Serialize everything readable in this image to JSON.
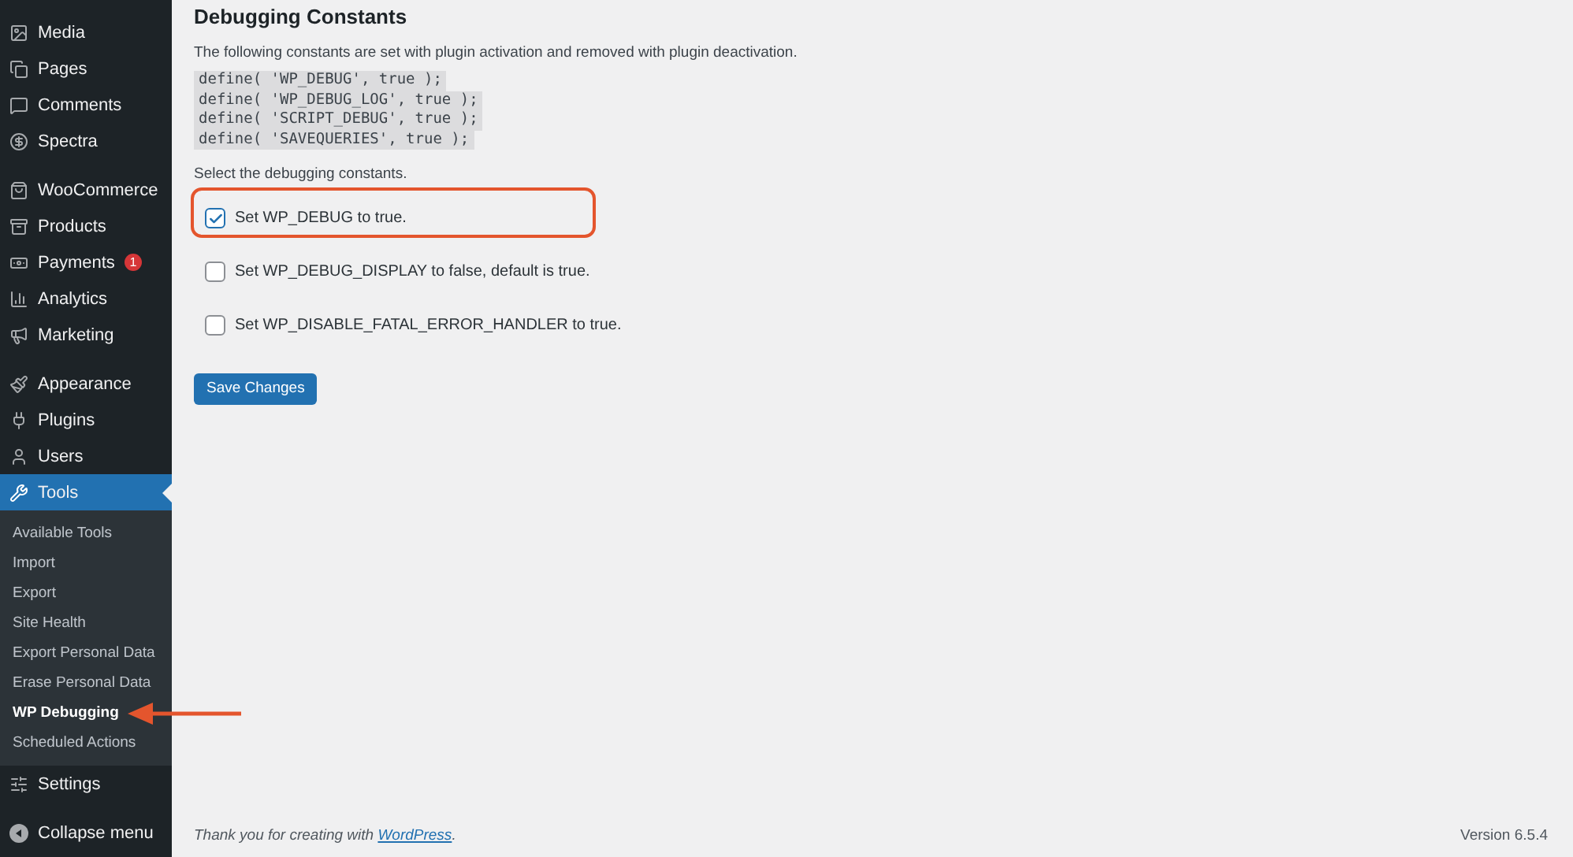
{
  "sidebar": {
    "groups": [
      [
        {
          "label": "Media",
          "selected": false
        },
        {
          "label": "Pages",
          "selected": false
        },
        {
          "label": "Comments",
          "selected": false
        },
        {
          "label": "Spectra",
          "selected": false
        }
      ],
      [
        {
          "label": "WooCommerce",
          "selected": false
        },
        {
          "label": "Products",
          "selected": false
        },
        {
          "label": "Payments",
          "selected": false,
          "badge": "1"
        },
        {
          "label": "Analytics",
          "selected": false
        },
        {
          "label": "Marketing",
          "selected": false
        }
      ],
      [
        {
          "label": "Appearance",
          "selected": false
        },
        {
          "label": "Plugins",
          "selected": false
        },
        {
          "label": "Users",
          "selected": false
        },
        {
          "label": "Tools",
          "selected": true,
          "children": [
            {
              "label": "Available Tools",
              "selected": false,
              "pointed": false
            },
            {
              "label": "Import",
              "selected": false,
              "pointed": false
            },
            {
              "label": "Export",
              "selected": false,
              "pointed": false
            },
            {
              "label": "Site Health",
              "selected": false,
              "pointed": false
            },
            {
              "label": "Export Personal Data",
              "selected": false,
              "pointed": false
            },
            {
              "label": "Erase Personal Data",
              "selected": false,
              "pointed": false
            },
            {
              "label": "WP Debugging",
              "selected": true,
              "pointed": true
            },
            {
              "label": "Scheduled Actions",
              "selected": false,
              "pointed": false
            }
          ]
        },
        {
          "label": "Settings",
          "selected": false
        }
      ]
    ],
    "collapse": "Collapse menu"
  },
  "content": {
    "title": "Debugging Constants",
    "intro": "The following constants are set with plugin activation and removed with plugin deactivation.",
    "code_lines": [
      "define( 'WP_DEBUG', true );",
      "define( 'WP_DEBUG_LOG', true );",
      "define( 'SCRIPT_DEBUG', true );",
      "define( 'SAVEQUERIES', true );"
    ],
    "prompt": "Select the debugging constants.",
    "options": [
      {
        "label": "Set WP_DEBUG to true.",
        "checked": true,
        "highlighted": true
      },
      {
        "label": "Set WP_DEBUG_DISPLAY to false, default is true.",
        "checked": false,
        "highlighted": false
      },
      {
        "label": "Set WP_DISABLE_FATAL_ERROR_HANDLER to true.",
        "checked": false,
        "highlighted": false
      }
    ],
    "save_button": "Save Changes"
  },
  "footer": {
    "thanks": "Thank you for creating with",
    "link": "WordPress",
    "after_link": ".",
    "version": "Version 6.5.4"
  }
}
